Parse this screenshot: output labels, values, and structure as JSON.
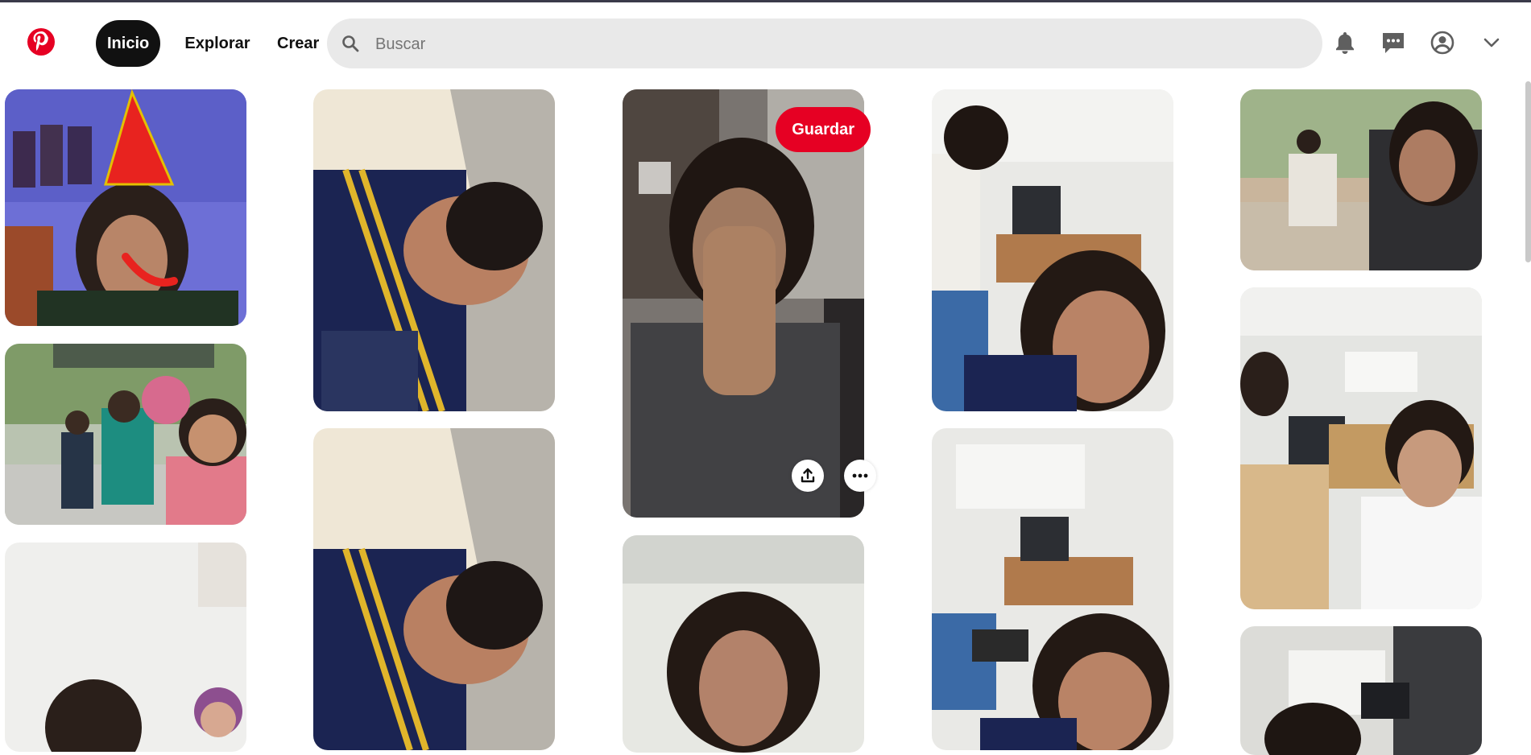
{
  "header": {
    "logo_icon": "pinterest-logo",
    "nav": {
      "home": "Inicio",
      "explore": "Explorar",
      "create": "Crear"
    },
    "search": {
      "placeholder": "Buscar",
      "value": ""
    },
    "icons": [
      "bell-icon",
      "messages-icon",
      "user-profile-icon",
      "chevron-down-icon"
    ]
  },
  "pin_actions": {
    "save_label": "Guardar"
  },
  "colors": {
    "brand": "#e60023",
    "search_bg": "#e9e9e9",
    "nav_active_bg": "#111111"
  },
  "pins": [
    {
      "id": "col1-pin1",
      "desc": "selfie with party hat drawing"
    },
    {
      "id": "col1-pin2",
      "desc": "group outdoors"
    },
    {
      "id": "col1-pin3",
      "desc": "two people indoors"
    },
    {
      "id": "col2-pin1",
      "desc": "tilted selfie"
    },
    {
      "id": "col2-pin2",
      "desc": "tilted selfie"
    },
    {
      "id": "col3-pin1",
      "desc": "selfie hovered"
    },
    {
      "id": "col3-pin2",
      "desc": "selfie classroom"
    },
    {
      "id": "col4-pin1",
      "desc": "classroom selfie"
    },
    {
      "id": "col4-pin2",
      "desc": "classroom selfie"
    },
    {
      "id": "col5-pin1",
      "desc": "window selfie"
    },
    {
      "id": "col5-pin2",
      "desc": "classroom group selfie"
    },
    {
      "id": "col5-pin3",
      "desc": "computer lab"
    }
  ]
}
